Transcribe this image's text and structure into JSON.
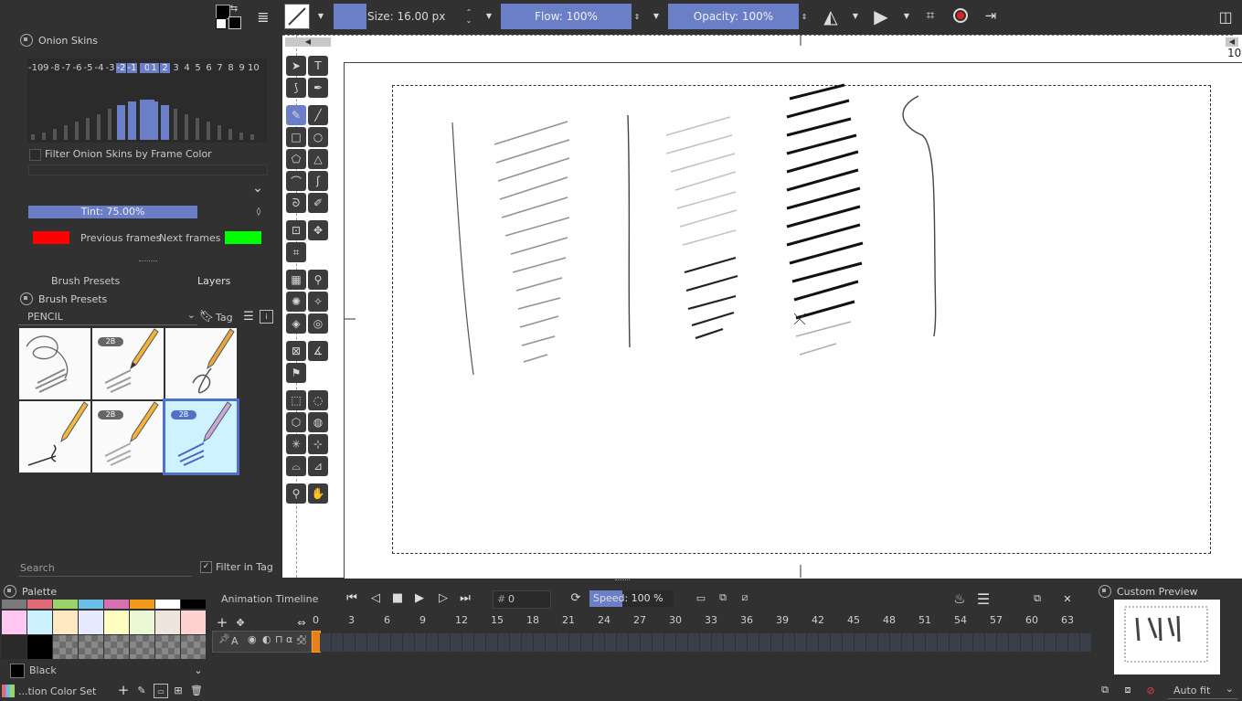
{
  "toolbar": {
    "size_label": "Size: 16.00 px",
    "flow_label": "Flow: 100%",
    "opacity_label": "Opacity: 100%"
  },
  "onion_skins": {
    "title": "Onion Skins",
    "numbers": [
      "-10",
      "-9",
      "-8",
      "-7",
      "-6",
      "-5",
      "-4",
      "-3",
      "-2",
      "-1",
      "0",
      "1",
      "2",
      "3",
      "4",
      "5",
      "6",
      "7",
      "8",
      "9",
      "10"
    ],
    "filter_label": "Filter Onion Skins by Frame Color",
    "tint_label": "Tint: 75.00%",
    "tint_value": 0.75,
    "previous_label": "Previous frames",
    "next_label": "Next frames",
    "previous_color": "#ff0000",
    "next_color": "#00ff00"
  },
  "dock_tabs": {
    "brush_presets": "Brush Presets",
    "layers": "Layers"
  },
  "brush_presets": {
    "title": "Brush Presets",
    "filter_value": "PENCIL",
    "tag_label": "Tag",
    "badge": "2B",
    "search_placeholder": "Search",
    "filter_in_tag": "Filter in Tag"
  },
  "palette": {
    "title": "Palette",
    "current_color_name": "Black",
    "color_set_label": "...tion Color Set",
    "row1": [
      "#7a7a7a",
      "#e06a78",
      "#9ad36a",
      "#6ac0e6",
      "#d670b0",
      "#f29a1c",
      "#ffffff",
      "#000000"
    ],
    "row2": [
      "#ffc7f2",
      "#cdf2ff",
      "#ffe9c4",
      "#e6e9ff",
      "#fffdc2",
      "#eaf8d6",
      "#eee6dc",
      "#ffd2d2"
    ]
  },
  "timeline": {
    "title": "Animation Timeline",
    "frame_prefix": "#",
    "frame_value": "0",
    "speed_label": "Speed: 100 %",
    "layer_name": "A",
    "frame_numbers": [
      "0",
      "3",
      "6",
      "9",
      "12",
      "15",
      "18",
      "21",
      "24",
      "27",
      "30",
      "33",
      "36",
      "39",
      "42",
      "45",
      "48",
      "51",
      "54",
      "57",
      "60",
      "63"
    ]
  },
  "custom_preview": {
    "title": "Custom Preview",
    "zoom_label": "Auto fit"
  },
  "ruler_label": "10",
  "accent": "#6b7fc8"
}
